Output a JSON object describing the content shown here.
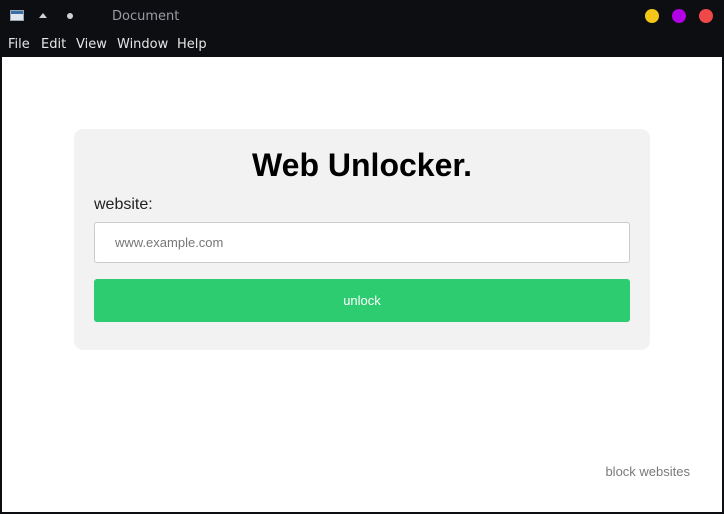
{
  "window": {
    "title": "Document",
    "icons": [
      "app-window-icon",
      "arrow-up-icon",
      "dot-icon"
    ],
    "controls": {
      "minimize_color": "#f5c518",
      "maximize_color": "#b300e6",
      "close_color": "#f04848"
    }
  },
  "menubar": {
    "items": [
      "File",
      "Edit",
      "View",
      "Window",
      "Help"
    ]
  },
  "card": {
    "title": "Web Unlocker.",
    "field_label": "website:",
    "input": {
      "value": "",
      "placeholder": "www.example.com"
    },
    "button_label": "unlock"
  },
  "footer": {
    "link_text": "block websites"
  },
  "colors": {
    "accent": "#2ecc71",
    "card_background": "#f2f2f2",
    "chrome_background": "#0d0e12"
  }
}
